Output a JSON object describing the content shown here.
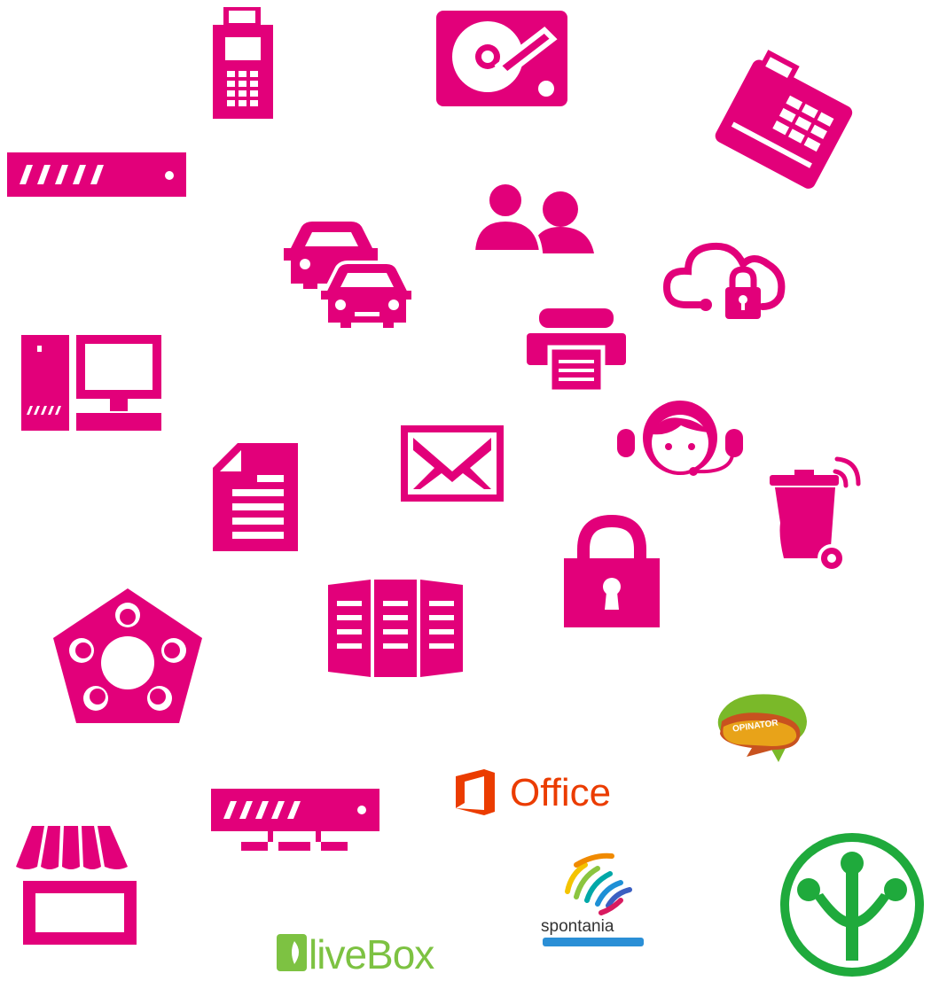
{
  "accent_color": "#e2007a",
  "icons": [
    "payment-terminal-icon",
    "hard-disk-icon",
    "cash-register-icon",
    "server-rack-icon",
    "users-icon",
    "cars-icon",
    "cloud-lock-icon",
    "fax-printer-icon",
    "desktop-computer-icon",
    "support-agent-icon",
    "document-icon",
    "envelope-icon",
    "smart-bin-icon",
    "padlock-icon",
    "open-book-icon",
    "people-circle-icon",
    "network-switch-icon",
    "shop-awning-icon"
  ],
  "logos": {
    "office": {
      "text": "Office",
      "color": "#eb3c00"
    },
    "opinator": {
      "text": "OPINATOR"
    },
    "spontania": {
      "text": "spontania"
    },
    "olivebox": {
      "text": "liveBox",
      "color": "#7dc242"
    },
    "green_tree": {
      "color": "#1faa3c"
    }
  }
}
